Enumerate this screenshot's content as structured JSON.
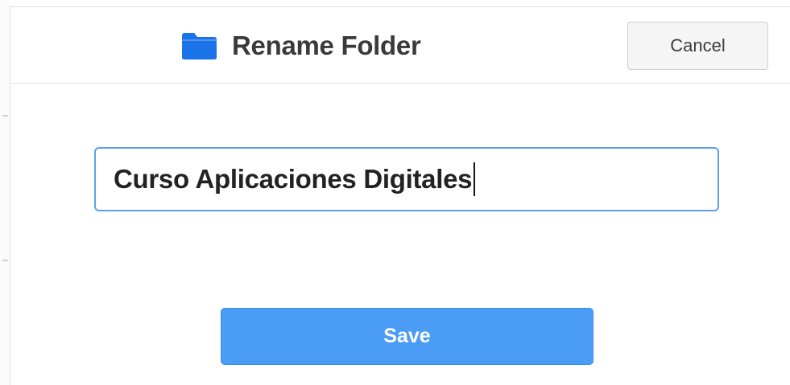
{
  "dialog": {
    "title": "Rename Folder",
    "title_icon": "folder-icon",
    "cancel_label": "Cancel",
    "folder_name_value": "Curso Aplicaciones Digitales",
    "save_label": "Save"
  },
  "colors": {
    "accent": "#4b9cf5",
    "folder_icon": "#1a73e8",
    "input_focus_border": "#5a9ff0"
  }
}
